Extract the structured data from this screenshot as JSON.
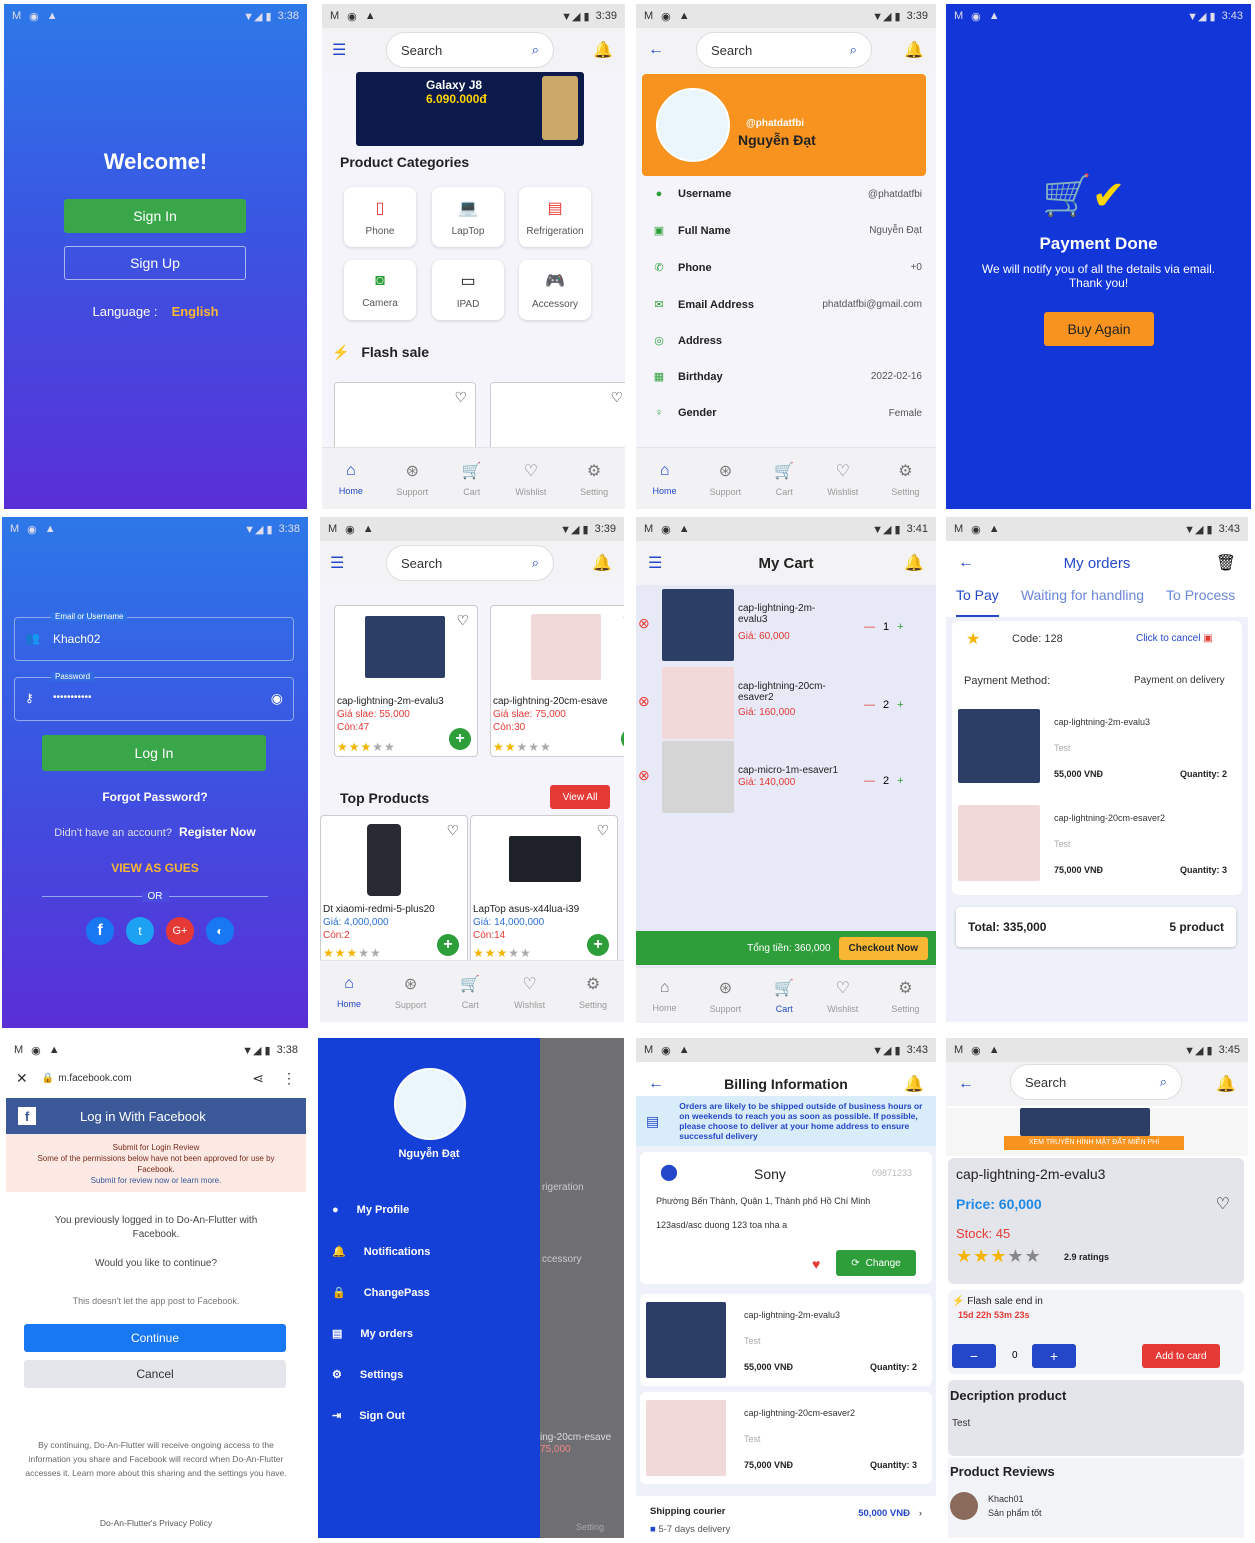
{
  "status_times": {
    "s1": "3:38",
    "s2": "3:39",
    "s3": "3:39",
    "s4": "3:43",
    "s5": "3:38",
    "s6": "3:39",
    "s7": "3:41",
    "s8": "3:43",
    "s9": "3:38",
    "s10": "3:39",
    "s11": "3:43",
    "s12": "3:45"
  },
  "welcome": {
    "title": "Welcome!",
    "sign_in": "Sign In",
    "sign_up": "Sign Up",
    "language_label": "Language :",
    "language_value": "English"
  },
  "home": {
    "search_placeholder": "Search",
    "banner_text": "Galaxy J8",
    "banner_price": "6.090.000đ",
    "categories_title": "Product Categories",
    "categories": [
      "Phone",
      "LapTop",
      "Refrigeration",
      "Camera",
      "IPAD",
      "Accessory"
    ],
    "flash_sale": "Flash sale"
  },
  "nav": {
    "home": "Home",
    "support": "Support",
    "cart": "Cart",
    "wishlist": "Wishlist",
    "setting": "Setting"
  },
  "profile": {
    "handle": "@phatdatfbi",
    "name": "Nguyễn Đạt",
    "rows": [
      {
        "label": "Username",
        "value": "@phatdatfbi"
      },
      {
        "label": "Full Name",
        "value": "Nguyễn Đạt"
      },
      {
        "label": "Phone",
        "value": "+0"
      },
      {
        "label": "Email Address",
        "value": "phatdatfbi@gmail.com"
      },
      {
        "label": "Address",
        "value": ""
      },
      {
        "label": "Birthday",
        "value": "2022-02-16"
      },
      {
        "label": "Gender",
        "value": "Female"
      }
    ]
  },
  "payment": {
    "title": "Payment Done",
    "msg1": "We will notify you of all the details via email.",
    "msg2": "Thank you!",
    "buy_again": "Buy Again"
  },
  "login": {
    "email_label": "Email or Username",
    "email_value": "Khach02",
    "password_label": "Password",
    "password_value": "•••••••••••",
    "login_btn": "Log In",
    "forgot": "Forgot Password?",
    "no_account": "Didn't have an account?",
    "register": "Register Now",
    "guest": "VIEW AS GUES",
    "or": "OR"
  },
  "products": {
    "p1": {
      "name": "cap-lightning-2m-evalu3",
      "price": "Giá slae: 55,000",
      "stock": "Còn:47"
    },
    "p2": {
      "name": "cap-lightning-20cm-esave",
      "price": "Giá slae: 75,000",
      "stock": "Còn:30"
    },
    "top_title": "Top Products",
    "view_all": "View All",
    "t1": {
      "name": "Dt xiaomi-redmi-5-plus20",
      "price": "Giá: 4,000,000",
      "stock": "Còn:2"
    },
    "t2": {
      "name": "LapTop asus-x44lua-i39",
      "price": "Giá: 14,000,000",
      "stock": "Còn:14"
    }
  },
  "cart": {
    "title": "My Cart",
    "items": [
      {
        "name": "cap-lightning-2m-evalu3",
        "price": "Giá: 60,000",
        "qty": "1"
      },
      {
        "name": "cap-lightning-20cm-esaver2",
        "price": "Giá: 160,000",
        "qty": "2"
      },
      {
        "name": "cap-micro-1m-esaver1",
        "price": "Giá: 140,000",
        "qty": "2"
      }
    ],
    "total": "Tổng tiền: 360,000",
    "checkout": "Checkout Now"
  },
  "orders": {
    "title": "My orders",
    "tabs": [
      "To Pay",
      "Waiting for handling",
      "To Process"
    ],
    "code": "Code: 128",
    "cancel": "Click to cancel",
    "pm_label": "Payment Method:",
    "pm_value": "Payment on delivery",
    "items": [
      {
        "name": "cap-lightning-2m-evalu3",
        "desc": "Test",
        "price": "55,000 VNĐ",
        "qty": "Quantity: 2"
      },
      {
        "name": "cap-lightning-20cm-esaver2",
        "desc": "Test",
        "price": "75,000 VNĐ",
        "qty": "Quantity: 3"
      }
    ],
    "total": "Total: 335,000",
    "count": "5 product"
  },
  "facebook": {
    "url": "m.facebook.com",
    "header": "Log in With Facebook",
    "warn1": "Submit for Login Review",
    "warn2": "Some of the permissions below have not been approved for use by Facebook.",
    "warn3": "Submit for review now or learn more.",
    "prev": "You previously logged in to Do-An-Flutter with Facebook.",
    "ask": "Would you like to continue?",
    "nopost": "This doesn't let the app post to Facebook.",
    "continue": "Continue",
    "cancel": "Cancel",
    "footer": "By continuing, Do-An-Flutter will receive ongoing access to the information you share and Facebook will record when Do-An-Flutter accesses it. Learn more about this sharing and the settings you have.",
    "policy": "Do-An-Flutter's Privacy Policy"
  },
  "drawer": {
    "name": "Nguyễn Đạt",
    "items": [
      "My Profile",
      "Notifications",
      "ChangePass",
      "My orders",
      "Settings",
      "Sign Out"
    ],
    "bg_text1": "rigeration",
    "bg_text2": "ccessory",
    "bg_text3": "ing-20cm-esave",
    "bg_text4": "75,000",
    "bg_setting": "Setting"
  },
  "billing": {
    "title": "Billing Information",
    "notice": "Orders are likely to be shipped outside of business hours or on weekends to reach you as soon as possible. If possible, please choose to deliver at your home address to ensure successful delivery",
    "name": "Sony",
    "phone": "09871233",
    "addr1": "Phường Bến Thành, Quận 1, Thành phố Hồ Chí Minh",
    "addr2": "123asd/asc duong 123 toa nha a",
    "change": "Change",
    "items": [
      {
        "name": "cap-lightning-2m-evalu3",
        "desc": "Test",
        "price": "55,000 VNĐ",
        "qty": "Quantity: 2"
      },
      {
        "name": "cap-lightning-20cm-esaver2",
        "desc": "Test",
        "price": "75,000 VNĐ",
        "qty": "Quantity: 3"
      }
    ],
    "ship_label": "Shipping courier",
    "ship_price": "50,000 VNĐ",
    "ship_days": "5-7 days delivery"
  },
  "detail": {
    "banner": "XEM TRUYỀN HÌNH MẶT ĐẤT MIỄN PHÍ",
    "name": "cap-lightning-2m-evalu3",
    "price": "Price: 60,000",
    "stock": "Stock: 45",
    "ratings": "2.9 ratings",
    "flash": "Flash sale end in",
    "countdown": "15d 22h 53m 23s",
    "qty": "0",
    "add": "Add to card",
    "desc_title": "Decription product",
    "desc": "Test",
    "reviews_title": "Product Reviews",
    "reviewer": "Khach01",
    "review": "Sản phẩm tốt"
  },
  "colors": {
    "primary": "#2447c9",
    "green": "#2e9e3a",
    "orange": "#f7931e",
    "red": "#e53935",
    "fb": "#3b5998"
  }
}
